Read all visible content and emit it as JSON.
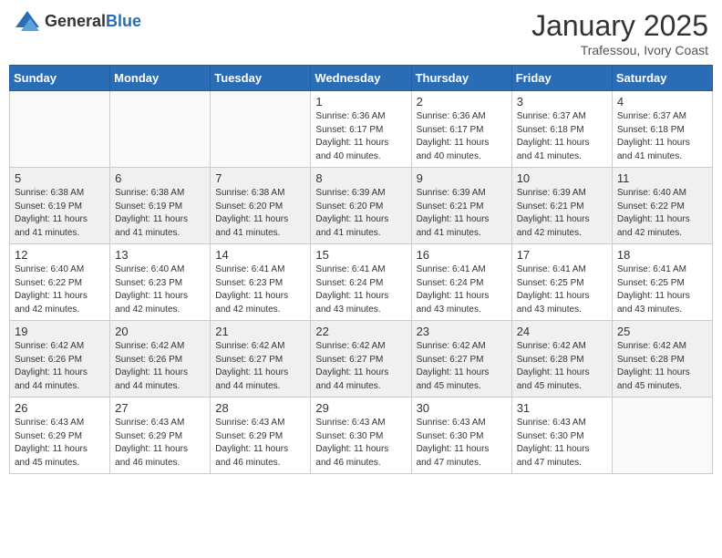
{
  "header": {
    "logo_general": "General",
    "logo_blue": "Blue",
    "month_title": "January 2025",
    "location": "Trafessou, Ivory Coast"
  },
  "days_of_week": [
    "Sunday",
    "Monday",
    "Tuesday",
    "Wednesday",
    "Thursday",
    "Friday",
    "Saturday"
  ],
  "weeks": [
    {
      "shaded": false,
      "days": [
        {
          "number": "",
          "info": ""
        },
        {
          "number": "",
          "info": ""
        },
        {
          "number": "",
          "info": ""
        },
        {
          "number": "1",
          "info": "Sunrise: 6:36 AM\nSunset: 6:17 PM\nDaylight: 11 hours and 40 minutes."
        },
        {
          "number": "2",
          "info": "Sunrise: 6:36 AM\nSunset: 6:17 PM\nDaylight: 11 hours and 40 minutes."
        },
        {
          "number": "3",
          "info": "Sunrise: 6:37 AM\nSunset: 6:18 PM\nDaylight: 11 hours and 41 minutes."
        },
        {
          "number": "4",
          "info": "Sunrise: 6:37 AM\nSunset: 6:18 PM\nDaylight: 11 hours and 41 minutes."
        }
      ]
    },
    {
      "shaded": true,
      "days": [
        {
          "number": "5",
          "info": "Sunrise: 6:38 AM\nSunset: 6:19 PM\nDaylight: 11 hours and 41 minutes."
        },
        {
          "number": "6",
          "info": "Sunrise: 6:38 AM\nSunset: 6:19 PM\nDaylight: 11 hours and 41 minutes."
        },
        {
          "number": "7",
          "info": "Sunrise: 6:38 AM\nSunset: 6:20 PM\nDaylight: 11 hours and 41 minutes."
        },
        {
          "number": "8",
          "info": "Sunrise: 6:39 AM\nSunset: 6:20 PM\nDaylight: 11 hours and 41 minutes."
        },
        {
          "number": "9",
          "info": "Sunrise: 6:39 AM\nSunset: 6:21 PM\nDaylight: 11 hours and 41 minutes."
        },
        {
          "number": "10",
          "info": "Sunrise: 6:39 AM\nSunset: 6:21 PM\nDaylight: 11 hours and 42 minutes."
        },
        {
          "number": "11",
          "info": "Sunrise: 6:40 AM\nSunset: 6:22 PM\nDaylight: 11 hours and 42 minutes."
        }
      ]
    },
    {
      "shaded": false,
      "days": [
        {
          "number": "12",
          "info": "Sunrise: 6:40 AM\nSunset: 6:22 PM\nDaylight: 11 hours and 42 minutes."
        },
        {
          "number": "13",
          "info": "Sunrise: 6:40 AM\nSunset: 6:23 PM\nDaylight: 11 hours and 42 minutes."
        },
        {
          "number": "14",
          "info": "Sunrise: 6:41 AM\nSunset: 6:23 PM\nDaylight: 11 hours and 42 minutes."
        },
        {
          "number": "15",
          "info": "Sunrise: 6:41 AM\nSunset: 6:24 PM\nDaylight: 11 hours and 43 minutes."
        },
        {
          "number": "16",
          "info": "Sunrise: 6:41 AM\nSunset: 6:24 PM\nDaylight: 11 hours and 43 minutes."
        },
        {
          "number": "17",
          "info": "Sunrise: 6:41 AM\nSunset: 6:25 PM\nDaylight: 11 hours and 43 minutes."
        },
        {
          "number": "18",
          "info": "Sunrise: 6:41 AM\nSunset: 6:25 PM\nDaylight: 11 hours and 43 minutes."
        }
      ]
    },
    {
      "shaded": true,
      "days": [
        {
          "number": "19",
          "info": "Sunrise: 6:42 AM\nSunset: 6:26 PM\nDaylight: 11 hours and 44 minutes."
        },
        {
          "number": "20",
          "info": "Sunrise: 6:42 AM\nSunset: 6:26 PM\nDaylight: 11 hours and 44 minutes."
        },
        {
          "number": "21",
          "info": "Sunrise: 6:42 AM\nSunset: 6:27 PM\nDaylight: 11 hours and 44 minutes."
        },
        {
          "number": "22",
          "info": "Sunrise: 6:42 AM\nSunset: 6:27 PM\nDaylight: 11 hours and 44 minutes."
        },
        {
          "number": "23",
          "info": "Sunrise: 6:42 AM\nSunset: 6:27 PM\nDaylight: 11 hours and 45 minutes."
        },
        {
          "number": "24",
          "info": "Sunrise: 6:42 AM\nSunset: 6:28 PM\nDaylight: 11 hours and 45 minutes."
        },
        {
          "number": "25",
          "info": "Sunrise: 6:42 AM\nSunset: 6:28 PM\nDaylight: 11 hours and 45 minutes."
        }
      ]
    },
    {
      "shaded": false,
      "days": [
        {
          "number": "26",
          "info": "Sunrise: 6:43 AM\nSunset: 6:29 PM\nDaylight: 11 hours and 45 minutes."
        },
        {
          "number": "27",
          "info": "Sunrise: 6:43 AM\nSunset: 6:29 PM\nDaylight: 11 hours and 46 minutes."
        },
        {
          "number": "28",
          "info": "Sunrise: 6:43 AM\nSunset: 6:29 PM\nDaylight: 11 hours and 46 minutes."
        },
        {
          "number": "29",
          "info": "Sunrise: 6:43 AM\nSunset: 6:30 PM\nDaylight: 11 hours and 46 minutes."
        },
        {
          "number": "30",
          "info": "Sunrise: 6:43 AM\nSunset: 6:30 PM\nDaylight: 11 hours and 47 minutes."
        },
        {
          "number": "31",
          "info": "Sunrise: 6:43 AM\nSunset: 6:30 PM\nDaylight: 11 hours and 47 minutes."
        },
        {
          "number": "",
          "info": ""
        }
      ]
    }
  ]
}
